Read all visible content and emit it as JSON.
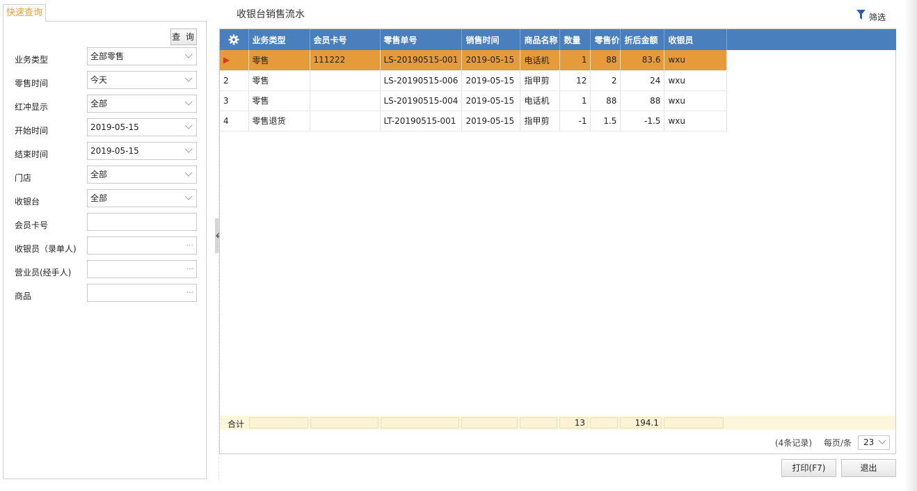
{
  "query_panel": {
    "tab_label": "快速查询",
    "query_button": "查 询",
    "fields": [
      {
        "label": "业务类型",
        "value": "全部零售",
        "kind": "select"
      },
      {
        "label": "零售时间",
        "value": "今天",
        "kind": "select"
      },
      {
        "label": "红冲显示",
        "value": "全部",
        "kind": "select"
      },
      {
        "label": "开始时间",
        "value": "2019-05-15",
        "kind": "select"
      },
      {
        "label": "结束时间",
        "value": "2019-05-15",
        "kind": "select"
      },
      {
        "label": "门店",
        "value": "全部",
        "kind": "select"
      },
      {
        "label": "收银台",
        "value": "全部",
        "kind": "select"
      },
      {
        "label": "会员卡号",
        "value": "",
        "kind": "text"
      },
      {
        "label": "收银员（录单人)",
        "value": "",
        "kind": "lookup"
      },
      {
        "label": "营业员(经手人)",
        "value": "",
        "kind": "lookup"
      },
      {
        "label": "商品",
        "value": "",
        "kind": "lookup"
      }
    ],
    "lookup_glyph": "···"
  },
  "page": {
    "title": "收银台销售流水",
    "filter_label": "筛选"
  },
  "grid": {
    "columns": [
      "业务类型",
      "会员卡号",
      "零售单号",
      "销售时间",
      "商品名称",
      "数量",
      "零售价",
      "折后金额",
      "收银员"
    ],
    "rows": [
      {
        "indicator": "▶",
        "type": "零售",
        "card": "111222",
        "order_no": "LS-20190515-001",
        "date": "2019-05-15",
        "product": "电话机",
        "qty": "1",
        "price": "88",
        "amount": "83.6",
        "cashier": "wxu"
      },
      {
        "indicator": "2",
        "type": "零售",
        "card": "",
        "order_no": "LS-20190515-006",
        "date": "2019-05-15",
        "product": "指甲剪",
        "qty": "12",
        "price": "2",
        "amount": "24",
        "cashier": "wxu"
      },
      {
        "indicator": "3",
        "type": "零售",
        "card": "",
        "order_no": "LS-20190515-004",
        "date": "2019-05-15",
        "product": "电话机",
        "qty": "1",
        "price": "88",
        "amount": "88",
        "cashier": "wxu"
      },
      {
        "indicator": "4",
        "type": "零售退货",
        "card": "",
        "order_no": "LT-20190515-001",
        "date": "2019-05-15",
        "product": "指甲剪",
        "qty": "-1",
        "price": "1.5",
        "amount": "-1.5",
        "cashier": "wxu"
      }
    ],
    "selected_row": 0,
    "summary": {
      "label": "合计",
      "qty": "13",
      "amount": "194.1"
    }
  },
  "pager": {
    "records": "(4条记录)",
    "per_page_label": "每页/条",
    "per_page_value": "23"
  },
  "buttons": {
    "print": "打印(F7)",
    "exit": "退出"
  },
  "colors": {
    "header": "#4a7fbd",
    "selected_row": "#e59b3a",
    "accent": "#e8a033",
    "summary_bg": "#fbf6dc"
  }
}
